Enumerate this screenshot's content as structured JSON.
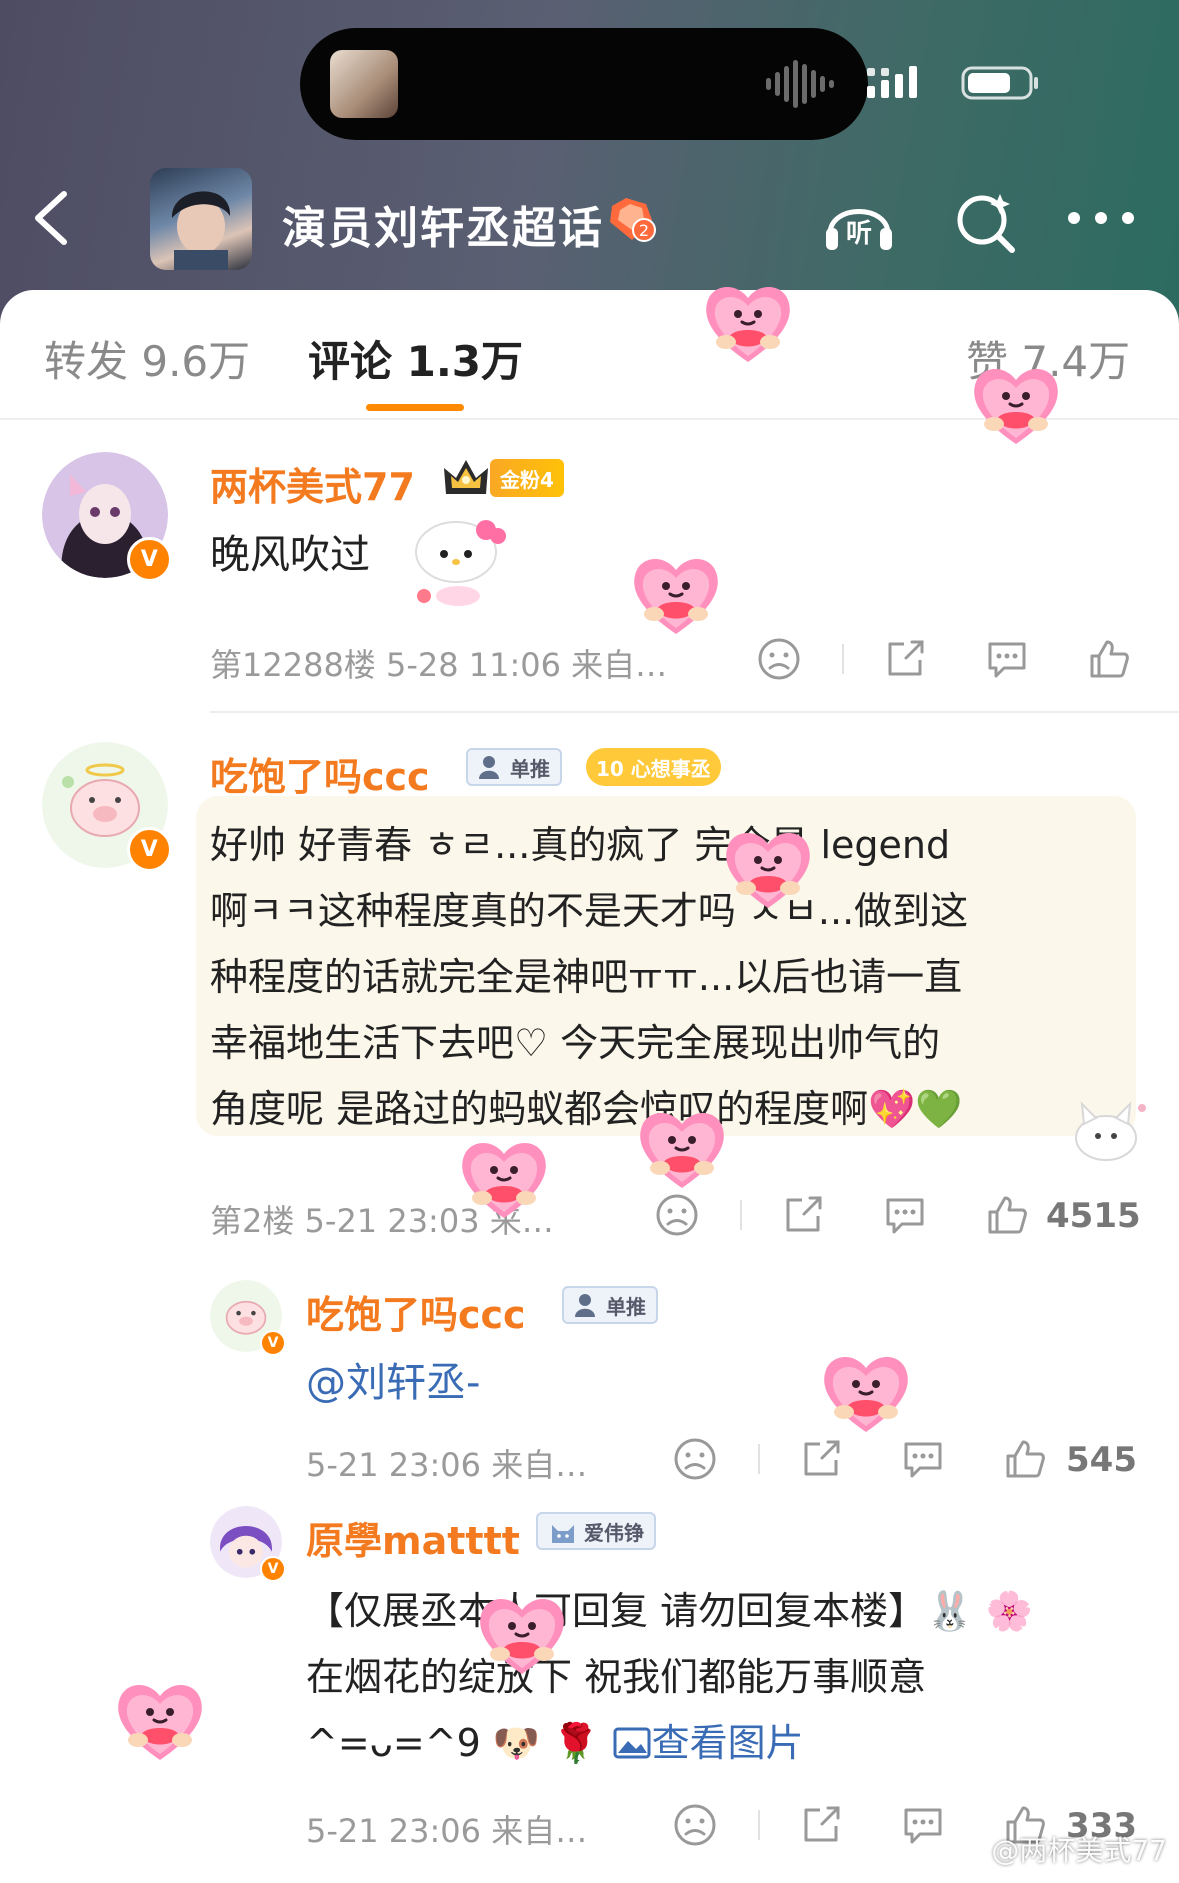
{
  "topic": {
    "title": "演员刘轩丞超话"
  },
  "tabs": {
    "repost": "转发 9.6万",
    "comments": "评论 1.3万",
    "likes": "赞 7.4万"
  },
  "comments": [
    {
      "user": "两杯美式77",
      "badge_fan": "金粉4",
      "text": "晚风吹过",
      "meta": "第12288楼 5-28 11:06 来自…"
    },
    {
      "user": "吃饱了吗ccc",
      "badge_solo": "单推",
      "badge_wish": "10 心想事丞",
      "lines": [
        "好帅 好青春 ㅎㄹ...真的疯了 完全是  legend",
        "啊ㅋㅋ这种程度真的不是天才吗 ㅅㅂ...做到这",
        "种程度的话就完全是神吧ㅠㅠ...以后也请一直",
        "幸福地生活下去吧♡  今天完全展现出帅气的",
        "角度呢 是路过的蚂蚁都会惊叹的程度啊💖💚"
      ],
      "meta": "第2楼 5-21 23:03 来…",
      "likes": "4515"
    }
  ],
  "replies": [
    {
      "user": "吃饱了吗ccc",
      "badge_solo": "单推",
      "mention": "@刘轩丞-",
      "meta": "5-21 23:06 来自…",
      "likes": "545"
    },
    {
      "user": "原學matttt",
      "badge_love": "爱伟铮",
      "lines": [
        "【仅展丞本人可回复 请勿回复本楼】🐰 🌸",
        "在烟花的绽放下 祝我们都能万事顺意",
        "^=ᴗ=^9 🐶 🌹 "
      ],
      "image_link": "查看图片",
      "meta": "5-21 23:06 来自…",
      "likes": "333"
    }
  ],
  "watermark": "@两杯美式77",
  "colors": {
    "brand_orange": "#ff8a00",
    "username": "#f47a1f",
    "link_blue": "#3a6bb5"
  }
}
